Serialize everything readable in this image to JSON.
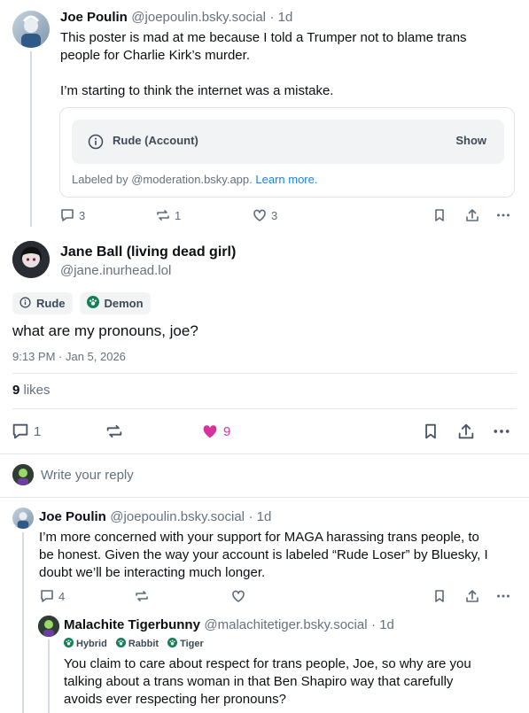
{
  "post1": {
    "author_name": "Joe Poulin",
    "author_handle": "@joepoulin.bsky.social",
    "age": "· 1d",
    "text_line1": "This poster is mad at me because I told a Trumper not to blame trans",
    "text_line2": "people for Charlie Kirk’s murder.",
    "text_line3": "I’m starting to think the internet was a mistake.",
    "label_title": "Rude (Account)",
    "label_show": "Show",
    "labeled_by": "Labeled by @moderation.bsky.app.",
    "learn_more": "Learn more.",
    "replies": "3",
    "reposts": "1",
    "likes": "3"
  },
  "main": {
    "author_name": "Jane Ball (living dead girl)",
    "author_handle": "@jane.inurhead.lol",
    "labels": [
      "Rude",
      "Demon"
    ],
    "text": "what are my pronouns, joe?",
    "timestamp": "9:13 PM · Jan 5, 2026",
    "likes_count": "9",
    "likes_word": "likes",
    "replies": "1",
    "like_count_action": "9",
    "like_color": "#d7339e"
  },
  "reply_box": {
    "placeholder": "Write your reply"
  },
  "reply1": {
    "author_name": "Joe Poulin",
    "author_handle": "@joepoulin.bsky.social",
    "age": "· 1d",
    "line1": "I’m more concerned with your support for MAGA harassing trans people, to",
    "line2": "be honest. Given the way your account is labeled “Rude Loser” by Bluesky, I",
    "line3": "doubt we’ll be interacting much longer.",
    "replies": "4"
  },
  "reply2": {
    "author_name": "Malachite Tigerbunny",
    "author_handle": "@malachitetiger.bsky.social",
    "age": "· 1d",
    "labels": [
      "Hybrid",
      "Rabbit",
      "Tiger"
    ],
    "line1": "You claim to care about respect for trans people, Joe, so why are you",
    "line2": "talking about a trans woman in that Ben Shapiro way that carefully",
    "line3": "avoids ever respecting her pronouns?"
  },
  "icons": [
    "reply-icon",
    "repost-icon",
    "heart-icon",
    "bookmark-icon",
    "share-icon",
    "more-icon",
    "info-icon",
    "paw-icon"
  ],
  "colors": {
    "accent": "#1083fe",
    "muted": "#66727f",
    "like": "#d7339e"
  }
}
